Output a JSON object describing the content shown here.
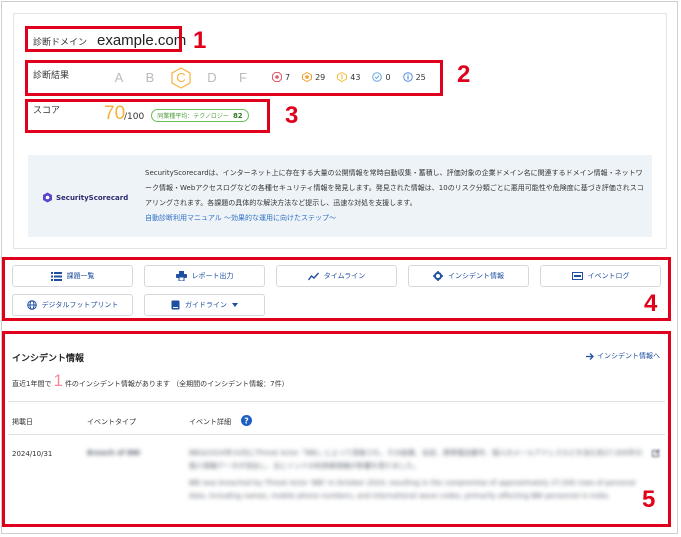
{
  "diagnosis": {
    "domain_label": "診断ドメイン",
    "domain_value": "example.com",
    "result_label": "診断結果",
    "grades": [
      "A",
      "B",
      "C",
      "D",
      "F"
    ],
    "active_grade": "C",
    "counts": [
      {
        "icon": "critical-icon",
        "value": "7",
        "color": "#e65a6e"
      },
      {
        "icon": "high-icon",
        "value": "29",
        "color": "#f0a030"
      },
      {
        "icon": "medium-icon",
        "value": "43",
        "color": "#f2c040"
      },
      {
        "icon": "low-icon",
        "value": "0",
        "color": "#6aa8e0"
      },
      {
        "icon": "info-icon",
        "value": "25",
        "color": "#5a8fd8"
      }
    ],
    "score_label": "スコア",
    "score_value": "70",
    "score_denominator": "/100",
    "score_badge_label": "同業種平均：テクノロジー",
    "score_badge_value": "82"
  },
  "info": {
    "logo_text": "SecurityScorecard",
    "description": "SecurityScorecardは、インターネット上に存在する大量の公開情報を常時自動収集・蓄積し、評価対象の企業ドメイン名に関連するドメイン情報・ネットワーク情報・Webアクセスログなどの各種セキュリティ情報を発見します。発見された情報は、10のリスク分類ごとに悪用可能性や危険度に基づき評価されスコアリングされます。各課題の具体的な解決方法など提示し、迅速な対処を支援します。",
    "link": "自動診断利用マニュアル ～効果的な運用に向けたステップ～"
  },
  "nav": {
    "issues": "課題一覧",
    "report": "レポート出力",
    "timeline": "タイムライン",
    "incident": "インシデント情報",
    "eventlog": "イベントログ",
    "footprint": "デジタルフットプリント",
    "guideline": "ガイドライン"
  },
  "incidents": {
    "title": "インシデント情報",
    "link": "インシデント情報へ",
    "summary_prefix": "直近1年間で",
    "summary_count": "1",
    "summary_suffix": "件のインシデント情報があります （全期間のインシデント情報：7件）",
    "col_date": "掲載日",
    "col_type": "イベントタイプ",
    "col_detail": "イベント詳細",
    "rows": [
      {
        "date": "2024/10/31",
        "type": "Breach of BBI",
        "detail_ja": "BBIは2024年10月にThreat Actor「BBI」によって侵害され、その結果、名前、携帯電話番号、個人のメールアドレスなどを含む約27,000件の個人情報データが流出し、主にインドの利用者情報が影響を受けました。",
        "detail_en": "BBI was breached by Threat Actor 'BBI' in October 2024, resulting in the compromise of approximately 27,000 rows of personal data, including names, mobile phone numbers, and international wave codes, primarily affecting BBI personnel in India."
      }
    ]
  },
  "callouts": [
    "1",
    "2",
    "3",
    "4",
    "5"
  ]
}
